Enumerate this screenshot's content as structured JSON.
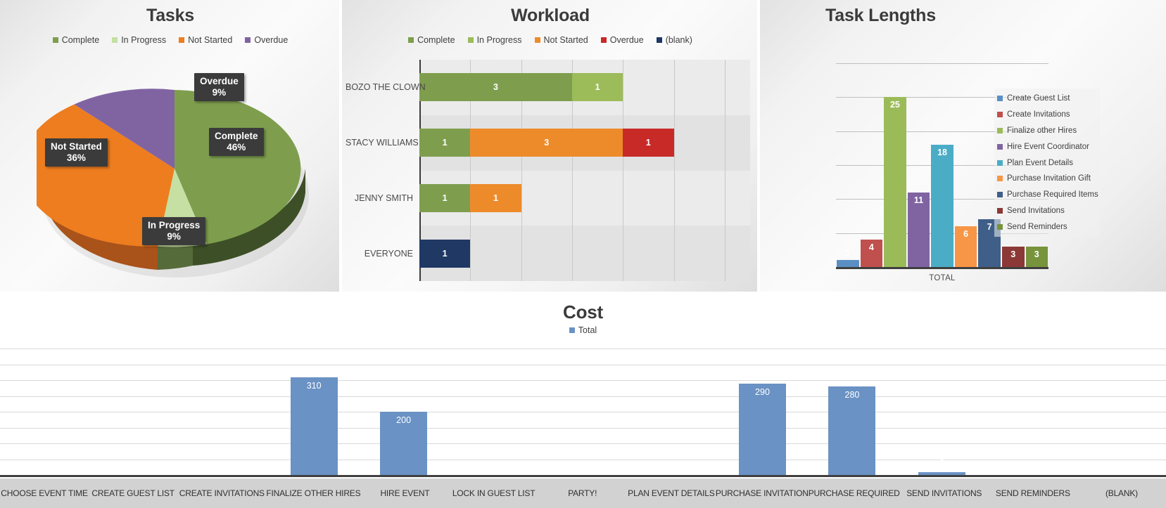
{
  "panels": {
    "tasks": {
      "title": "Tasks"
    },
    "workload": {
      "title": "Workload"
    },
    "task_lengths": {
      "title": "Task Lengths"
    },
    "cost": {
      "title": "Cost"
    }
  },
  "chart_data": [
    {
      "id": "tasks",
      "type": "pie",
      "title": "Tasks",
      "three_d": true,
      "legend_position": "top",
      "categories": [
        "Complete",
        "In Progress",
        "Not Started",
        "Overdue"
      ],
      "values": [
        46,
        9,
        36,
        9
      ],
      "value_unit": "percent",
      "data_labels": [
        {
          "label": "Complete",
          "value": "46%"
        },
        {
          "label": "In Progress",
          "value": "9%"
        },
        {
          "label": "Not Started",
          "value": "36%"
        },
        {
          "label": "Overdue",
          "value": "9%"
        }
      ],
      "colors": [
        "#7e9e4e",
        "#c6dfa2",
        "#ed7d1f",
        "#8064a2"
      ],
      "legend": [
        {
          "label": "Complete",
          "color": "#7e9e4e"
        },
        {
          "label": "In Progress",
          "color": "#c6dfa2"
        },
        {
          "label": "Not Started",
          "color": "#ed7d1f"
        },
        {
          "label": "Overdue",
          "color": "#8064a2"
        }
      ]
    },
    {
      "id": "workload",
      "type": "bar",
      "orientation": "horizontal",
      "stacked": true,
      "title": "Workload",
      "legend_position": "top",
      "xlabel": "",
      "ylabel": "",
      "xlim": [
        0,
        6.5
      ],
      "grid": true,
      "categories": [
        "BOZO THE CLOWN",
        "STACY WILLIAMS",
        "JENNY SMITH",
        "EVERYONE"
      ],
      "series": [
        {
          "name": "Complete",
          "color": "#7e9e4e",
          "values": [
            3,
            1,
            1,
            0
          ]
        },
        {
          "name": "In Progress",
          "color": "#9cbb59",
          "values": [
            1,
            0,
            0,
            0
          ]
        },
        {
          "name": "Not Started",
          "color": "#ed8b2b",
          "values": [
            0,
            3,
            1,
            0
          ]
        },
        {
          "name": "Overdue",
          "color": "#c82a28",
          "values": [
            0,
            1,
            0,
            0
          ]
        },
        {
          "name": "(blank)",
          "color": "#1f3864",
          "values": [
            0,
            0,
            0,
            1
          ]
        }
      ],
      "legend": [
        {
          "label": "Complete",
          "color": "#7e9e4e"
        },
        {
          "label": "In Progress",
          "color": "#9cbb59"
        },
        {
          "label": "Not Started",
          "color": "#ed8b2b"
        },
        {
          "label": "Overdue",
          "color": "#c82a28"
        },
        {
          "label": "(blank)",
          "color": "#1f3864"
        }
      ]
    },
    {
      "id": "task_lengths",
      "type": "bar",
      "orientation": "vertical",
      "title": "Task Lengths",
      "legend_position": "right",
      "xlabel": "TOTAL",
      "ylabel": "",
      "ylim": [
        0,
        30
      ],
      "grid": true,
      "categories": [
        "Create Guest List",
        "Create Invitations",
        "Finalize other Hires",
        "Hire Event Coordinator",
        "Plan Event Details",
        "Purchase Invitation Gift",
        "Purchase Required Items",
        "Send Invitations",
        "Send Reminders"
      ],
      "values": [
        1,
        4,
        25,
        11,
        18,
        6,
        7,
        3,
        3
      ],
      "colors": [
        "#5b8fc4",
        "#c0504d",
        "#9bbb59",
        "#8064a2",
        "#4bacc6",
        "#f79646",
        "#3f5f88",
        "#8c3836",
        "#77933c"
      ],
      "legend": [
        {
          "label": "Create Guest List",
          "color": "#5b8fc4"
        },
        {
          "label": "Create Invitations",
          "color": "#c0504d"
        },
        {
          "label": "Finalize other Hires",
          "color": "#9bbb59"
        },
        {
          "label": "Hire Event Coordinator",
          "color": "#8064a2"
        },
        {
          "label": "Plan Event Details",
          "color": "#4bacc6"
        },
        {
          "label": "Purchase Invitation Gift",
          "color": "#f79646"
        },
        {
          "label": "Purchase Required Items",
          "color": "#3f5f88"
        },
        {
          "label": "Send Invitations",
          "color": "#8c3836"
        },
        {
          "label": "Send Reminders",
          "color": "#77933c"
        }
      ]
    },
    {
      "id": "cost",
      "type": "bar",
      "orientation": "vertical",
      "title": "Cost",
      "legend_position": "top",
      "legend": [
        {
          "label": "Total",
          "color": "#6a92c4"
        }
      ],
      "series_name": "Total",
      "xlabel": "",
      "ylabel": "",
      "ylim": [
        0,
        400
      ],
      "grid": true,
      "bar_color": "#6a92c4",
      "categories": [
        "CHOOSE EVENT TIME",
        "CREATE GUEST LIST",
        "CREATE INVITATIONS",
        "FINALIZE OTHER HIRES",
        "HIRE EVENT",
        "LOCK IN GUEST LIST",
        "PARTY!",
        "PLAN EVENT DETAILS",
        "PURCHASE INVITATION",
        "PURCHASE REQUIRED",
        "SEND INVITATIONS",
        "SEND REMINDERS",
        "(BLANK)"
      ],
      "values": [
        0,
        0,
        0,
        310,
        200,
        0,
        0,
        0,
        290,
        280,
        8,
        0,
        0
      ],
      "data_labels": [
        "",
        "",
        "",
        "310",
        "200",
        "",
        "",
        "",
        "290",
        "280",
        "8",
        "",
        ""
      ]
    }
  ]
}
